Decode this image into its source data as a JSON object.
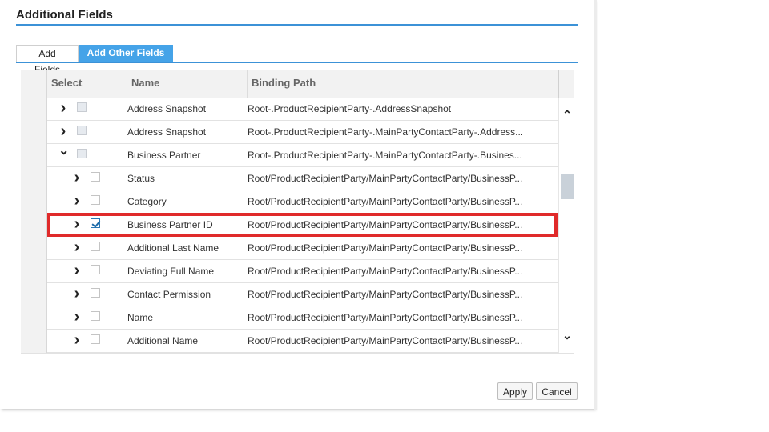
{
  "dialog": {
    "title": "Additional Fields"
  },
  "tabs": [
    {
      "label": "Add Fields",
      "active": false
    },
    {
      "label": "Add Other Fields",
      "active": true
    }
  ],
  "table": {
    "columns": [
      "Select",
      "Name",
      "Binding Path"
    ],
    "rows": [
      {
        "name": "Address Snapshot",
        "path": "Root-.ProductRecipientParty-.AddressSnapshot",
        "level": 0,
        "expanded": false,
        "checked": false,
        "disabled": true
      },
      {
        "name": "Address Snapshot",
        "path": "Root-.ProductRecipientParty-.MainPartyContactParty-.Address...",
        "level": 0,
        "expanded": false,
        "checked": false,
        "disabled": true
      },
      {
        "name": "Business Partner",
        "path": "Root-.ProductRecipientParty-.MainPartyContactParty-.Busines...",
        "level": 0,
        "expanded": true,
        "checked": false,
        "disabled": true
      },
      {
        "name": "Status",
        "path": "Root/ProductRecipientParty/MainPartyContactParty/BusinessP...",
        "level": 1,
        "expanded": false,
        "checked": false,
        "disabled": false
      },
      {
        "name": "Category",
        "path": "Root/ProductRecipientParty/MainPartyContactParty/BusinessP...",
        "level": 1,
        "expanded": false,
        "checked": false,
        "disabled": false
      },
      {
        "name": "Business Partner ID",
        "path": "Root/ProductRecipientParty/MainPartyContactParty/BusinessP...",
        "level": 1,
        "expanded": false,
        "checked": true,
        "disabled": false
      },
      {
        "name": "Additional Last Name",
        "path": "Root/ProductRecipientParty/MainPartyContactParty/BusinessP...",
        "level": 1,
        "expanded": false,
        "checked": false,
        "disabled": false
      },
      {
        "name": "Deviating Full Name",
        "path": "Root/ProductRecipientParty/MainPartyContactParty/BusinessP...",
        "level": 1,
        "expanded": false,
        "checked": false,
        "disabled": false
      },
      {
        "name": "Contact Permission",
        "path": "Root/ProductRecipientParty/MainPartyContactParty/BusinessP...",
        "level": 1,
        "expanded": false,
        "checked": false,
        "disabled": false
      },
      {
        "name": "Name",
        "path": "Root/ProductRecipientParty/MainPartyContactParty/BusinessP...",
        "level": 1,
        "expanded": false,
        "checked": false,
        "disabled": false
      },
      {
        "name": "Additional Name",
        "path": "Root/ProductRecipientParty/MainPartyContactParty/BusinessP...",
        "level": 1,
        "expanded": false,
        "checked": false,
        "disabled": false
      }
    ]
  },
  "buttons": {
    "apply": "Apply",
    "cancel": "Cancel"
  },
  "icons": {
    "expand": "chevron-right-icon",
    "collapse": "chevron-down-icon",
    "scroll_up": "chevron-up-icon",
    "scroll_down": "chevron-down-icon"
  },
  "colors": {
    "accent": "#3c92d7",
    "active_tab": "#45a3e8",
    "highlight": "#e02a2a"
  }
}
